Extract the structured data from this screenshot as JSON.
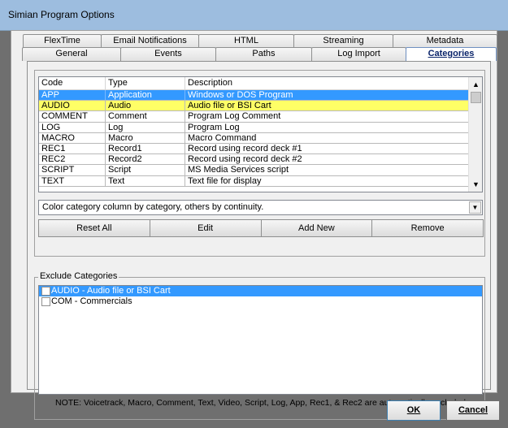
{
  "window": {
    "title": "Simian Program Options"
  },
  "tabs": {
    "row1": [
      "FlexTime",
      "Email Notifications",
      "HTML",
      "Streaming",
      "Metadata"
    ],
    "row2": [
      "General",
      "Events",
      "Paths",
      "Log Import",
      "Categories"
    ],
    "active": "Categories"
  },
  "list": {
    "headers": {
      "code": "Code",
      "type": "Type",
      "description": "Description"
    },
    "rows": [
      {
        "code": "APP",
        "type": "Application",
        "description": "Windows or DOS Program",
        "state": "selected"
      },
      {
        "code": "AUDIO",
        "type": "Audio",
        "description": "Audio file or BSI Cart",
        "state": "highlight"
      },
      {
        "code": "COMMENT",
        "type": "Comment",
        "description": "Program Log Comment",
        "state": ""
      },
      {
        "code": "LOG",
        "type": "Log",
        "description": "Program Log",
        "state": ""
      },
      {
        "code": "MACRO",
        "type": "Macro",
        "description": "Macro Command",
        "state": ""
      },
      {
        "code": "REC1",
        "type": "Record1",
        "description": "Record using record deck #1",
        "state": ""
      },
      {
        "code": "REC2",
        "type": "Record2",
        "description": "Record using record deck #2",
        "state": ""
      },
      {
        "code": "SCRIPT",
        "type": "Script",
        "description": "MS Media Services script",
        "state": ""
      },
      {
        "code": "TEXT",
        "type": "Text",
        "description": "Text file for display",
        "state": ""
      }
    ]
  },
  "color_combo": {
    "value": "Color category column by category, others by continuity."
  },
  "buttons": {
    "reset_all": "Reset All",
    "edit": "Edit",
    "add_new": "Add New",
    "remove": "Remove"
  },
  "exclude": {
    "legend": "Exclude Categories",
    "items": [
      {
        "label": "AUDIO  -  Audio file or BSI Cart",
        "checked": false,
        "selected": true
      },
      {
        "label": "COM  -  Commercials",
        "checked": false,
        "selected": false
      }
    ],
    "note": "NOTE: Voicetrack, Macro, Comment, Text, Video, Script, Log, App, Rec1, & Rec2 are automatically excluded"
  },
  "dialog_buttons": {
    "ok": "OK",
    "cancel": "Cancel"
  },
  "colors": {
    "selection": "#3399ff",
    "highlight": "#ffff66",
    "titlebar": "#9dbddf"
  }
}
